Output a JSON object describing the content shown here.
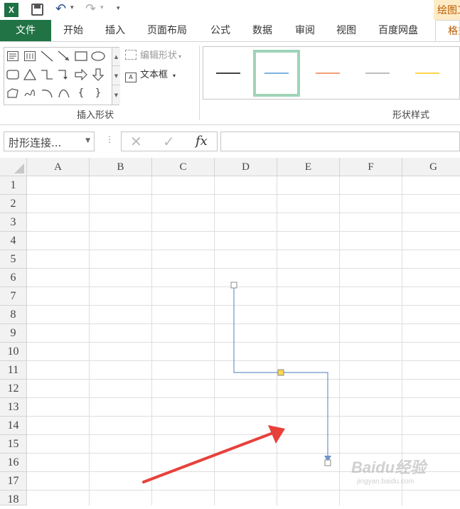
{
  "title_bar": {
    "app_icon": "X",
    "context_tab": "绘图工具"
  },
  "tabs": [
    {
      "label": "文件"
    },
    {
      "label": "开始"
    },
    {
      "label": "插入"
    },
    {
      "label": "页面布局"
    },
    {
      "label": "公式"
    },
    {
      "label": "数据"
    },
    {
      "label": "审阅"
    },
    {
      "label": "视图"
    },
    {
      "label": "百度网盘"
    },
    {
      "label": "格式"
    }
  ],
  "ribbon": {
    "edit_shape": "编辑形状",
    "text_box": "文本框",
    "insert_shapes_label": "插入形状",
    "shape_styles_label": "形状样式",
    "style_colors": [
      "#444444",
      "#7bb4e0",
      "#f4a07a",
      "#bdbdbd",
      "#ffd54f"
    ]
  },
  "formula_bar": {
    "name_box": "肘形连接...",
    "cancel": "✕",
    "enter": "✓",
    "fx": "fx",
    "content": ""
  },
  "sheet": {
    "columns": [
      "A",
      "B",
      "C",
      "D",
      "E",
      "F",
      "G"
    ],
    "rows": [
      "1",
      "2",
      "3",
      "4",
      "5",
      "6",
      "7",
      "8",
      "9",
      "10",
      "11",
      "12",
      "13",
      "14",
      "15",
      "16",
      "17",
      "18"
    ]
  },
  "watermark": {
    "text": "Baidu经验",
    "sub": "jingyan.baidu.com"
  },
  "colors": {
    "file_tab": "#217346",
    "context_accent": "#b95a00",
    "connector": "#6f95c6",
    "arrow": "#e8403b",
    "selected_style_border": "#9fd4b9"
  }
}
